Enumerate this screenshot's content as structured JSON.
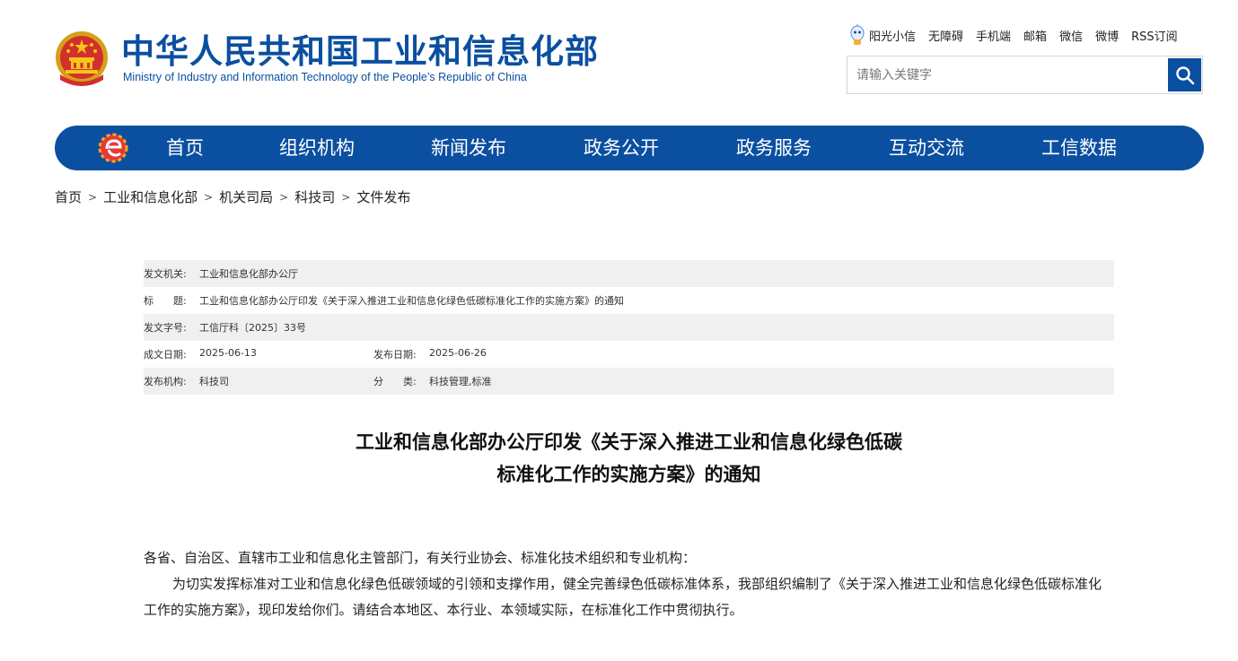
{
  "header": {
    "title_cn": "中华人民共和国工业和信息化部",
    "title_en": "Ministry of Industry and Information Technology of the People’s Republic of China",
    "emblem_icon": "national-emblem-icon"
  },
  "top_links": [
    "阳光小信",
    "无障碍",
    "手机端",
    "邮箱",
    "微信",
    "微博",
    "RSS订阅"
  ],
  "search": {
    "placeholder": "请输入关键字",
    "button_icon": "search-icon"
  },
  "nav": {
    "items": [
      "首页",
      "组织机构",
      "新闻发布",
      "政务公开",
      "政务服务",
      "互动交流",
      "工信数据"
    ],
    "color": "#0b4fa0"
  },
  "breadcrumb": [
    "首页",
    "工业和信息化部",
    "机关司局",
    "科技司",
    "文件发布"
  ],
  "info": {
    "issuer_label": "发文机关:",
    "issuer": "工业和信息化部办公厅",
    "title_label": "标　　题:",
    "title": "工业和信息化部办公厅印发《关于深入推进工业和信息化绿色低碳标准化工作的实施方案》的通知",
    "doc_no_label": "发文字号:",
    "doc_no": "工信厅科〔2025〕33号",
    "created_label": "成文日期:",
    "created": "2025-06-13",
    "published_label": "发布日期:",
    "published": "2025-06-26",
    "org_label": "发布机构:",
    "org": "科技司",
    "category_label": "分　　类:",
    "category": "科技管理,标准"
  },
  "document": {
    "title_line1": "工业和信息化部办公厅印发《关于深入推进工业和信息化绿色低碳",
    "title_line2": "标准化工作的实施方案》的通知",
    "salutation": "各省、自治区、直辖市工业和信息化主管部门，有关行业协会、标准化技术组织和专业机构：",
    "paragraph1": "为切实发挥标准对工业和信息化绿色低碳领域的引领和支撑作用，健全完善绿色低碳标准体系，我部组织编制了《关于深入推进工业和信息化绿色低碳标准化工作的实施方案》，现印发给你们。请结合本地区、本行业、本领域实际，在标准化工作中贯彻执行。"
  }
}
